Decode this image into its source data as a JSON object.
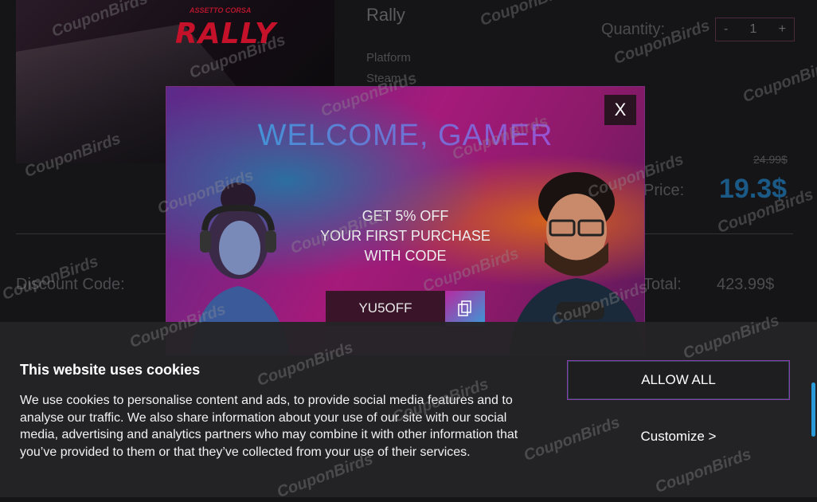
{
  "product": {
    "logo_top": "ASSETTO CORSA",
    "logo": "RALLY",
    "name": "Rally",
    "platform_label": "Platform",
    "platform_value": "Steam",
    "quantity_label": "Quantity:",
    "qty_minus": "-",
    "qty_value": "1",
    "qty_plus": "+",
    "old_price": "24.99$",
    "price_label": "Price:",
    "price": "19.3$"
  },
  "checkout": {
    "discount_label": "Discount Code:",
    "total_label": "Total:",
    "total_value": "423.99$"
  },
  "watermark": "CouponBirds",
  "modal": {
    "close_label": "X",
    "title": "WELCOME, GAMER",
    "offer_line1": "GET 5% OFF",
    "offer_line2": "YOUR FIRST PURCHASE",
    "offer_line3": "WITH CODE",
    "code": "YU5OFF",
    "copy_icon": "copy-icon"
  },
  "cookie": {
    "title": "This website uses cookies",
    "text": "We use cookies to personalise content and ads, to provide social media features and to analyse our traffic. We also share information about your use of our site with our social media, advertising and analytics partners who may combine it with other information that you’ve provided to them or that they’ve collected from your use of their services.",
    "allow_label": "ALLOW ALL",
    "customize_label": "Customize >"
  },
  "colors": {
    "accent_blue": "#2aa6d8",
    "accent_purple": "#b23fd0",
    "background": "#151518"
  }
}
